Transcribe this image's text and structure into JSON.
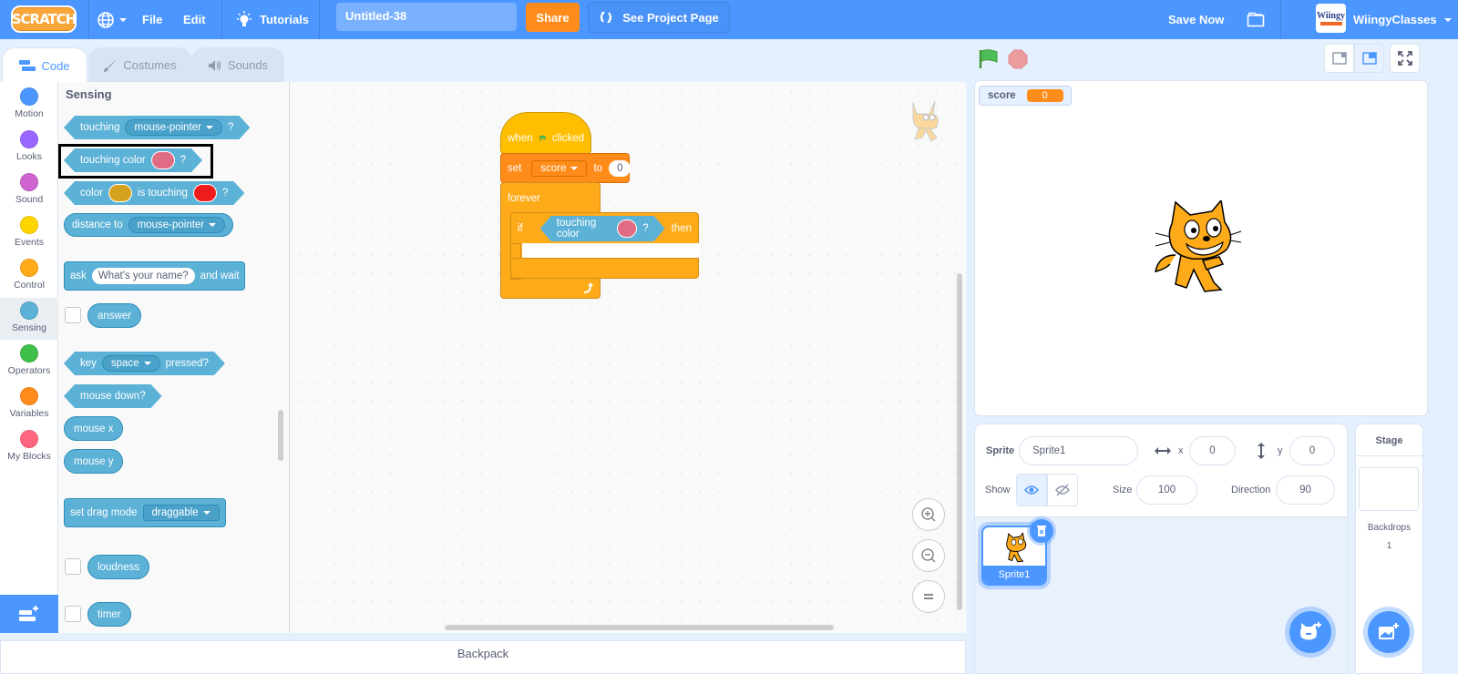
{
  "menubar": {
    "logo": "SCRATCH",
    "language_icon": "globe-icon",
    "file": "File",
    "edit": "Edit",
    "tutorials": "Tutorials",
    "project_title": "Untitled-38",
    "share": "Share",
    "see_project_page": "See Project Page",
    "save_now": "Save Now",
    "avatar_text": "Wiingy",
    "username": "WiingyClasses"
  },
  "tabs": [
    {
      "label": "Code",
      "active": true
    },
    {
      "label": "Costumes",
      "active": false
    },
    {
      "label": "Sounds",
      "active": false
    }
  ],
  "categories": [
    {
      "label": "Motion",
      "color": "#4c97ff"
    },
    {
      "label": "Looks",
      "color": "#9966ff"
    },
    {
      "label": "Sound",
      "color": "#cf63cf"
    },
    {
      "label": "Events",
      "color": "#ffd500"
    },
    {
      "label": "Control",
      "color": "#ffab19"
    },
    {
      "label": "Sensing",
      "color": "#5cb1d6",
      "selected": true
    },
    {
      "label": "Operators",
      "color": "#40bf4a"
    },
    {
      "label": "Variables",
      "color": "#ff8c1a"
    },
    {
      "label": "My Blocks",
      "color": "#ff6680"
    }
  ],
  "palette": {
    "title": "Sensing",
    "touching": {
      "label": "touching",
      "option": "mouse-pointer",
      "suffix": "?"
    },
    "touching_color": {
      "label": "touching color",
      "color": "#e06c84",
      "suffix": "?"
    },
    "color_touching": {
      "label1": "color",
      "color1": "#d5a21d",
      "label2": "is touching",
      "color2": "#ee1c1c",
      "suffix": "?"
    },
    "distance_to": {
      "label": "distance to",
      "option": "mouse-pointer"
    },
    "ask": {
      "label": "ask",
      "input": "What's your name?",
      "suffix": "and wait"
    },
    "answer": "answer",
    "key_pressed": {
      "label": "key",
      "option": "space",
      "suffix": "pressed?"
    },
    "mouse_down": "mouse down?",
    "mouse_x": "mouse x",
    "mouse_y": "mouse y",
    "set_drag_mode": {
      "label": "set drag mode",
      "option": "draggable"
    },
    "loudness": "loudness",
    "timer": "timer"
  },
  "script": {
    "when_clicked": {
      "label1": "when",
      "label2": "clicked"
    },
    "set_var": {
      "label": "set",
      "variable": "score",
      "to": "to",
      "value": "0"
    },
    "forever": "forever",
    "if_block": {
      "label": "if",
      "condition": "touching color",
      "suffix": "?",
      "then": "then",
      "color": "#e06c84"
    }
  },
  "backpack": "Backpack",
  "stage": {
    "monitor_label": "score",
    "monitor_value": "0"
  },
  "sprite_info": {
    "sprite_label": "Sprite",
    "sprite_name": "Sprite1",
    "x_label": "x",
    "x": "0",
    "y_label": "y",
    "y": "0",
    "show_label": "Show",
    "size_label": "Size",
    "size": "100",
    "direction_label": "Direction",
    "direction": "90"
  },
  "sprites": [
    {
      "name": "Sprite1",
      "selected": true
    }
  ],
  "stage_pane": {
    "title": "Stage",
    "backdrops_label": "Backdrops",
    "backdrops_count": "1"
  }
}
